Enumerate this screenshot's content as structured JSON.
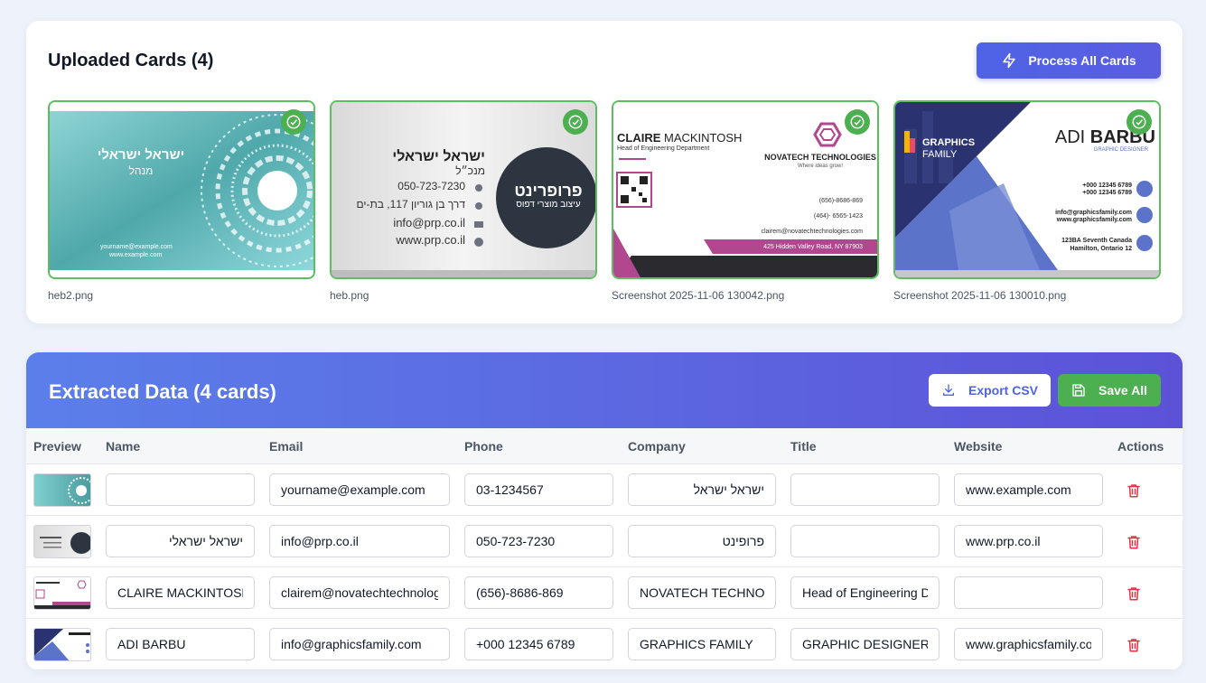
{
  "upload": {
    "title": "Uploaded Cards (4)",
    "process_label": "Process All Cards",
    "cards": [
      {
        "file": "heb2.png",
        "name_text": "ישראל ישראלי",
        "role_text": "מנהל",
        "lines": [
          "yourname@example.com",
          "www.example.com"
        ]
      },
      {
        "file": "heb.png",
        "name_text": "ישראל ישראלי",
        "role_text": "מנכ״ל",
        "logo_text": "פרופרינט",
        "logo_sub": "עיצוב מוצרי דפוס",
        "lines": [
          "050-723-7230",
          "דרך בן גוריון 117, בת-ים",
          "info@prp.co.il",
          "www.prp.co.il"
        ]
      },
      {
        "file": "Screenshot 2025-11-06 130042.png",
        "name_bold": "CLAIRE",
        "name_rest": " MACKINTOSH",
        "role_text": "Head of Engineering Department",
        "company": "NOVATECH TECHNOLOGIES",
        "tagline": "Where ideas grow!",
        "lines": [
          "(656)-8686-869",
          "(464)- 6565-1423",
          "clairem@novatechtechnologies.com",
          "425 Hidden Valley Road, NY 87903"
        ]
      },
      {
        "file": "Screenshot 2025-11-06 130010.png",
        "name_light": "ADI ",
        "name_bold": "BARBU",
        "role_text": "GRAPHIC DESIGNER",
        "company": "GRAPHICS",
        "company2": "FAMILY",
        "lines": [
          "+000 12345 6789",
          "+000 12345 6789",
          "info@graphicsfamily.com",
          "www.graphicsfamily.com",
          "123BA Seventh Canada",
          "Hamilton, Ontario 12"
        ]
      }
    ]
  },
  "extracted": {
    "title": "Extracted Data (4 cards)",
    "export_label": "Export CSV",
    "save_label": "Save All",
    "columns": [
      "Preview",
      "Name",
      "Email",
      "Phone",
      "Company",
      "Title",
      "Website",
      "Actions"
    ],
    "rows": [
      {
        "name": "",
        "email": "yourname@example.com",
        "phone": "03-1234567",
        "company": "ישראל ישראל",
        "title": "",
        "website": "www.example.com"
      },
      {
        "name": "ישראל ישראלי",
        "email": "info@prp.co.il",
        "phone": "050-723-7230",
        "company": "פרופינט",
        "title": "",
        "website": "www.prp.co.il"
      },
      {
        "name": "CLAIRE MACKINTOSH",
        "email": "clairem@novatechtechnologies.com",
        "phone": "(656)-8686-869",
        "company": "NOVATECH TECHNOLOGIES",
        "title": "Head of Engineering Department",
        "website": ""
      },
      {
        "name": "ADI BARBU",
        "email": "info@graphicsfamily.com",
        "phone": "+000 12345 6789",
        "company": "GRAPHICS FAMILY",
        "title": "GRAPHIC DESIGNER",
        "website": "www.graphicsfamily.com"
      }
    ]
  },
  "colors": {
    "accent": "#4f63e6",
    "success": "#4caf50",
    "danger": "#dc3545",
    "header_from": "#5b7fea",
    "header_to": "#5c52d8"
  },
  "icons": {
    "process": "lightning-icon",
    "check": "check-circle-icon",
    "export": "download-icon",
    "save": "floppy-disk-icon",
    "delete": "trash-icon"
  }
}
